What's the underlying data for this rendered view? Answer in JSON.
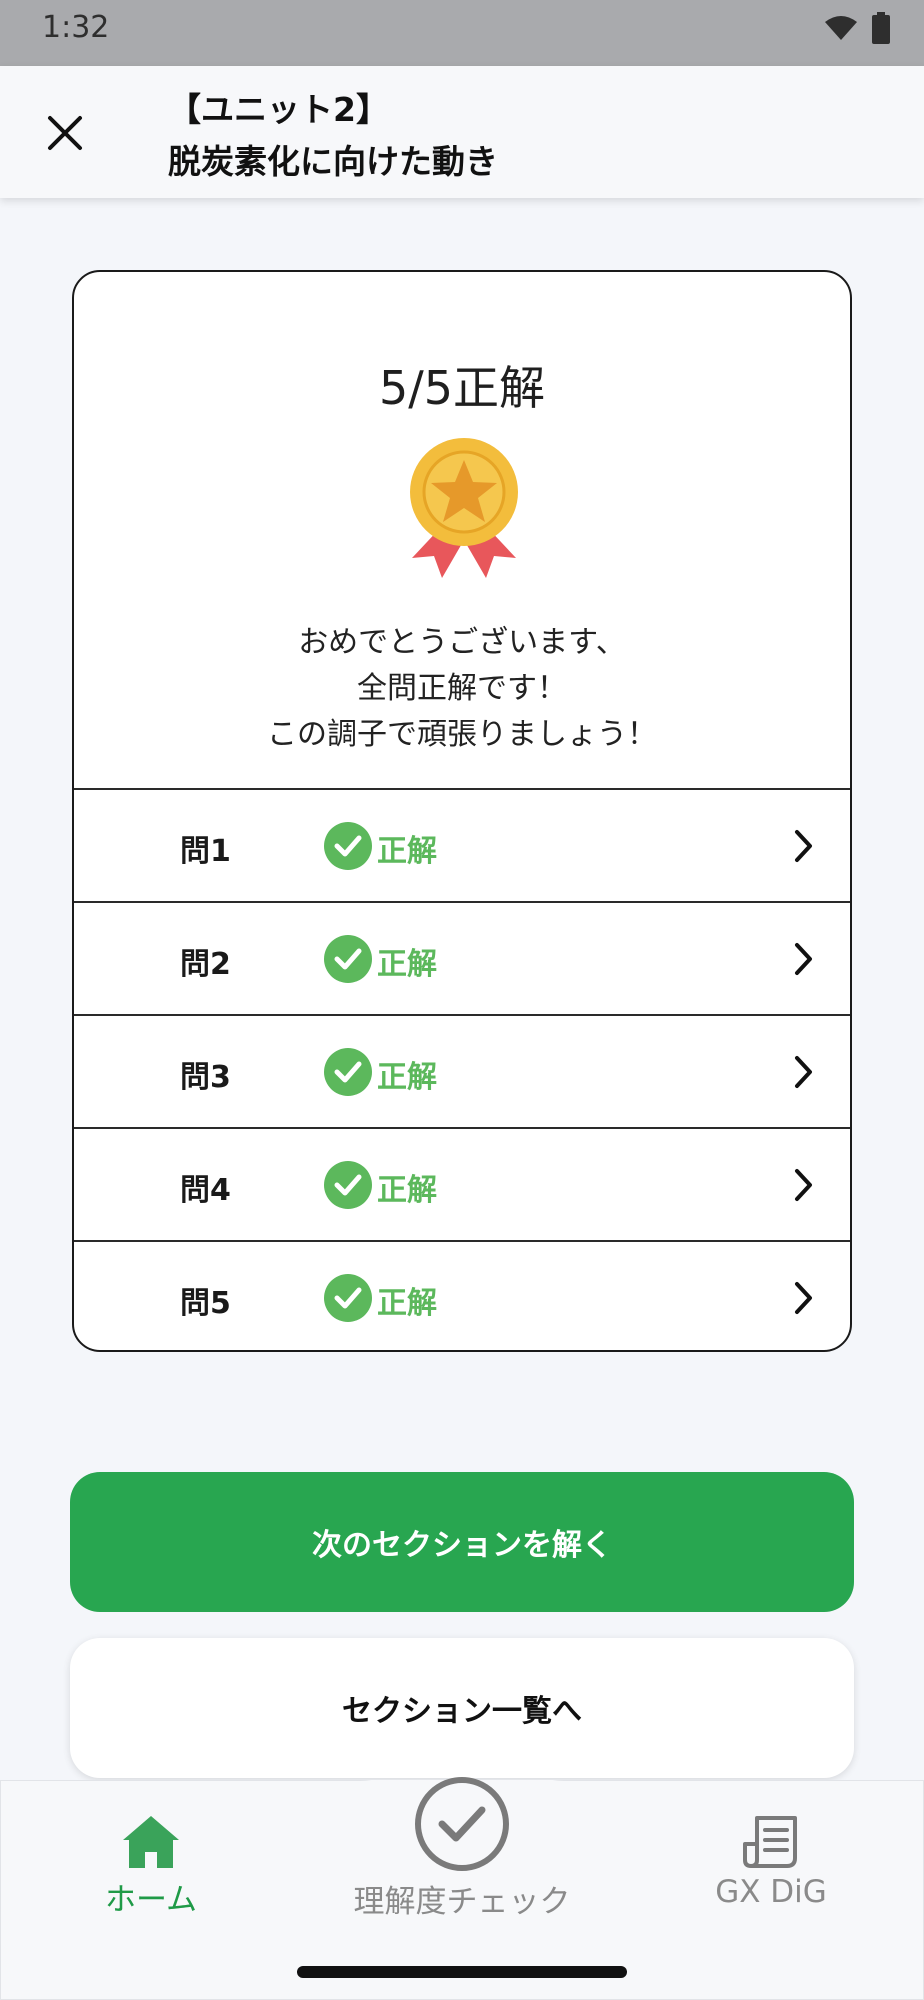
{
  "status_bar": {
    "time": "1:32",
    "icons": [
      "wifi-icon",
      "battery-icon"
    ]
  },
  "header": {
    "title_line1": "【ユニット2】",
    "title_line2": "脱炭素化に向けた動き",
    "close_icon": "close-icon"
  },
  "result": {
    "score": "5/5正解",
    "message_line1": "おめでとうございます、",
    "message_line2": "全問正解です！",
    "message_line3": "この調子で頑張りましょう！",
    "questions": [
      {
        "label": "問1",
        "status": "正解"
      },
      {
        "label": "問2",
        "status": "正解"
      },
      {
        "label": "問3",
        "status": "正解"
      },
      {
        "label": "問4",
        "status": "正解"
      },
      {
        "label": "問5",
        "status": "正解"
      }
    ]
  },
  "actions": {
    "next_section": "次のセクションを解く",
    "section_list": "セクション一覧へ"
  },
  "bottom_nav": {
    "items": [
      {
        "label": "ホーム",
        "icon": "home-icon",
        "active": true
      },
      {
        "label": "理解度チェック",
        "icon": "check-circle-icon",
        "active": false
      },
      {
        "label": "GX DiG",
        "icon": "document-icon",
        "active": false
      }
    ]
  },
  "colors": {
    "accent_green": "#28a650",
    "correct_green": "#5cb85c",
    "background": "#f4f6fa"
  }
}
